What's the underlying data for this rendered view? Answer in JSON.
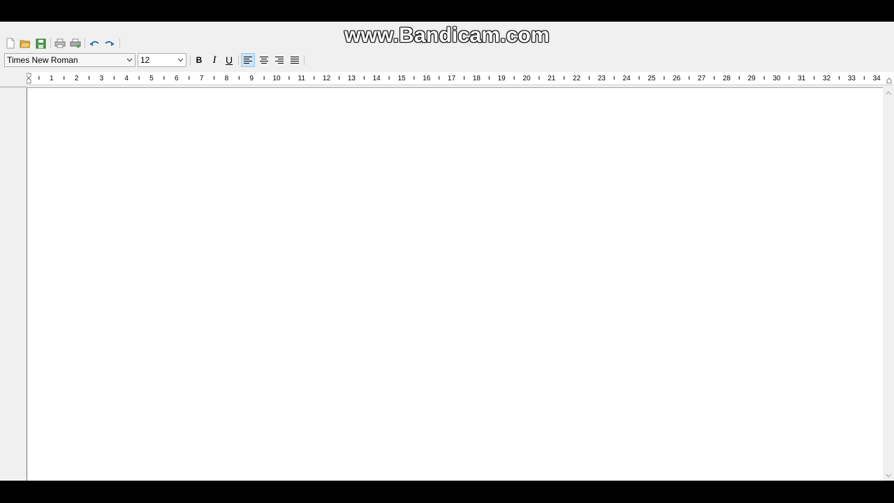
{
  "watermark": "www.Bandicam.com",
  "toolbar": {
    "icons": [
      "new-document-icon",
      "open-folder-icon",
      "save-icon",
      "print-preview-icon",
      "print-icon",
      "undo-icon",
      "redo-icon"
    ]
  },
  "format_bar": {
    "font_family": "Times New Roman",
    "font_size": "12",
    "bold_label": "B",
    "italic_label": "I",
    "underline_label": "U",
    "alignment": "left"
  },
  "ruler": {
    "labels": [
      "1",
      "2",
      "3",
      "4",
      "5",
      "6",
      "7",
      "8",
      "9",
      "10",
      "11",
      "12",
      "13",
      "14",
      "15",
      "16",
      "17",
      "18",
      "19",
      "20",
      "21",
      "22",
      "23",
      "24",
      "25",
      "26",
      "27",
      "28",
      "29",
      "30",
      "31",
      "32",
      "33",
      "34"
    ]
  },
  "document": {
    "content": ""
  },
  "colors": {
    "chrome": "#f0f0f0",
    "active_button": "#cce4f7",
    "letterbox": "#000000"
  }
}
